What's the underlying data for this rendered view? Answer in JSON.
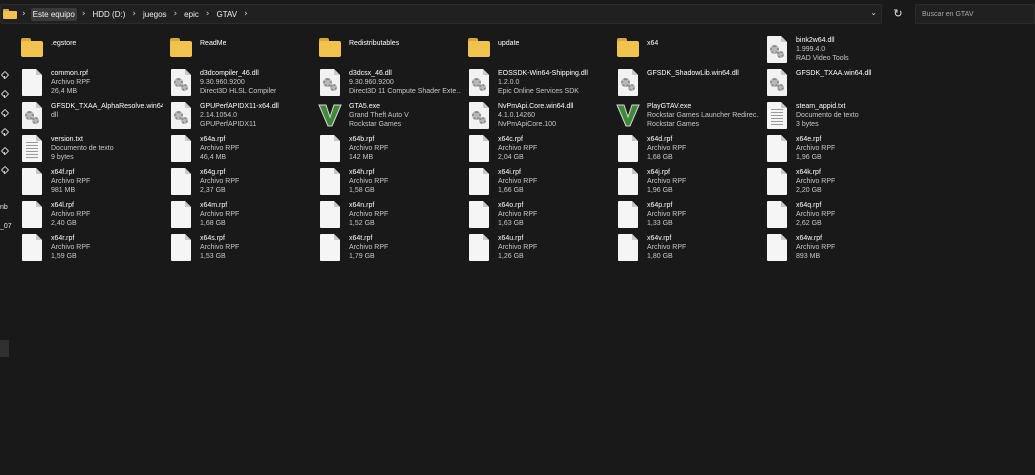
{
  "breadcrumb": [
    "Este equipo",
    "HDD (D:)",
    "juegos",
    "epic",
    "GTAV"
  ],
  "search": {
    "placeholder": "Buscar en GTAV"
  },
  "nav_clipped": {
    "text1": "nb",
    "text2": "_07"
  },
  "icons": {
    "folder": "folder-icon",
    "file": "file-icon",
    "dll": "dll-gears-icon",
    "text": "text-file-icon",
    "gta": "gta-v-icon",
    "pin": "pin-icon",
    "refresh": "refresh-icon",
    "chevron": "chevron-down-icon"
  },
  "colors": {
    "background": "#191919",
    "folder": "#f2c24f",
    "gta_green": "#3f8a3a"
  },
  "items": [
    {
      "kind": "folder",
      "name": ".egstore"
    },
    {
      "kind": "folder",
      "name": "ReadMe"
    },
    {
      "kind": "folder",
      "name": "Redistributables"
    },
    {
      "kind": "folder",
      "name": "update"
    },
    {
      "kind": "folder",
      "name": "x64"
    },
    {
      "kind": "dll",
      "name": "bink2w64.dll",
      "l2": "1.999.4.0",
      "l3": "RAD Video Tools"
    },
    {
      "kind": "file",
      "name": "common.rpf",
      "l2": "Archivo RPF",
      "l3": "26,4 MB"
    },
    {
      "kind": "dll",
      "name": "d3dcompiler_46.dll",
      "l2": "9.30.960.9200",
      "l3": "Direct3D HLSL Compiler"
    },
    {
      "kind": "dll",
      "name": "d3dcsx_46.dll",
      "l2": "9.30.960.9200",
      "l3": "Direct3D 11 Compute Shader Exte..."
    },
    {
      "kind": "dll",
      "name": "EOSSDK-Win64-Shipping.dll",
      "l2": "1.2.0.0",
      "l3": "Epic Online Services SDK"
    },
    {
      "kind": "dll",
      "name": "GFSDK_ShadowLib.win64.dll"
    },
    {
      "kind": "dll",
      "name": "GFSDK_TXAA.win64.dll"
    },
    {
      "kind": "dll",
      "name": "GFSDK_TXAA_AlphaResolve.win64.",
      "l2": "dll"
    },
    {
      "kind": "dll",
      "name": "GPUPerfAPIDX11-x64.dll",
      "l2": "2.14.1054.0",
      "l3": "GPUPerfAPIDX11"
    },
    {
      "kind": "gta",
      "name": "GTA5.exe",
      "l2": "Grand Theft Auto V",
      "l3": "Rockstar Games"
    },
    {
      "kind": "dll",
      "name": "NvPmApi.Core.win64.dll",
      "l2": "4.1.0.14260",
      "l3": "NvPmApiCore.100"
    },
    {
      "kind": "gta",
      "name": "PlayGTAV.exe",
      "l2": "Rockstar Games Launcher Redirec...",
      "l3": "Rockstar Games"
    },
    {
      "kind": "text",
      "name": "steam_appid.txt",
      "l2": "Documento de texto",
      "l3": "3 bytes"
    },
    {
      "kind": "text",
      "name": "version.txt",
      "l2": "Documento de texto",
      "l3": "9 bytes"
    },
    {
      "kind": "file",
      "name": "x64a.rpf",
      "l2": "Archivo RPF",
      "l3": "46,4 MB"
    },
    {
      "kind": "file",
      "name": "x64b.rpf",
      "l2": "Archivo RPF",
      "l3": "142 MB"
    },
    {
      "kind": "file",
      "name": "x64c.rpf",
      "l2": "Archivo RPF",
      "l3": "2,04 GB"
    },
    {
      "kind": "file",
      "name": "x64d.rpf",
      "l2": "Archivo RPF",
      "l3": "1,68 GB"
    },
    {
      "kind": "file",
      "name": "x64e.rpf",
      "l2": "Archivo RPF",
      "l3": "1,96 GB"
    },
    {
      "kind": "file",
      "name": "x64f.rpf",
      "l2": "Archivo RPF",
      "l3": "981 MB"
    },
    {
      "kind": "file",
      "name": "x64g.rpf",
      "l2": "Archivo RPF",
      "l3": "2,37 GB"
    },
    {
      "kind": "file",
      "name": "x64h.rpf",
      "l2": "Archivo RPF",
      "l3": "1,58 GB"
    },
    {
      "kind": "file",
      "name": "x64i.rpf",
      "l2": "Archivo RPF",
      "l3": "1,66 GB"
    },
    {
      "kind": "file",
      "name": "x64j.rpf",
      "l2": "Archivo RPF",
      "l3": "1,96 GB"
    },
    {
      "kind": "file",
      "name": "x64k.rpf",
      "l2": "Archivo RPF",
      "l3": "2,20 GB"
    },
    {
      "kind": "file",
      "name": "x64l.rpf",
      "l2": "Archivo RPF",
      "l3": "2,40 GB"
    },
    {
      "kind": "file",
      "name": "x64m.rpf",
      "l2": "Archivo RPF",
      "l3": "1,68 GB"
    },
    {
      "kind": "file",
      "name": "x64n.rpf",
      "l2": "Archivo RPF",
      "l3": "1,52 GB"
    },
    {
      "kind": "file",
      "name": "x64o.rpf",
      "l2": "Archivo RPF",
      "l3": "1,63 GB"
    },
    {
      "kind": "file",
      "name": "x64p.rpf",
      "l2": "Archivo RPF",
      "l3": "1,33 GB"
    },
    {
      "kind": "file",
      "name": "x64q.rpf",
      "l2": "Archivo RPF",
      "l3": "2,62 GB"
    },
    {
      "kind": "file",
      "name": "x64r.rpf",
      "l2": "Archivo RPF",
      "l3": "1,59 GB"
    },
    {
      "kind": "file",
      "name": "x64s.rpf",
      "l2": "Archivo RPF",
      "l3": "1,53 GB"
    },
    {
      "kind": "file",
      "name": "x64t.rpf",
      "l2": "Archivo RPF",
      "l3": "1,79 GB"
    },
    {
      "kind": "file",
      "name": "x64u.rpf",
      "l2": "Archivo RPF",
      "l3": "1,26 GB"
    },
    {
      "kind": "file",
      "name": "x64v.rpf",
      "l2": "Archivo RPF",
      "l3": "1,80 GB"
    },
    {
      "kind": "file",
      "name": "x64w.rpf",
      "l2": "Archivo RPF",
      "l3": "893 MB"
    }
  ]
}
